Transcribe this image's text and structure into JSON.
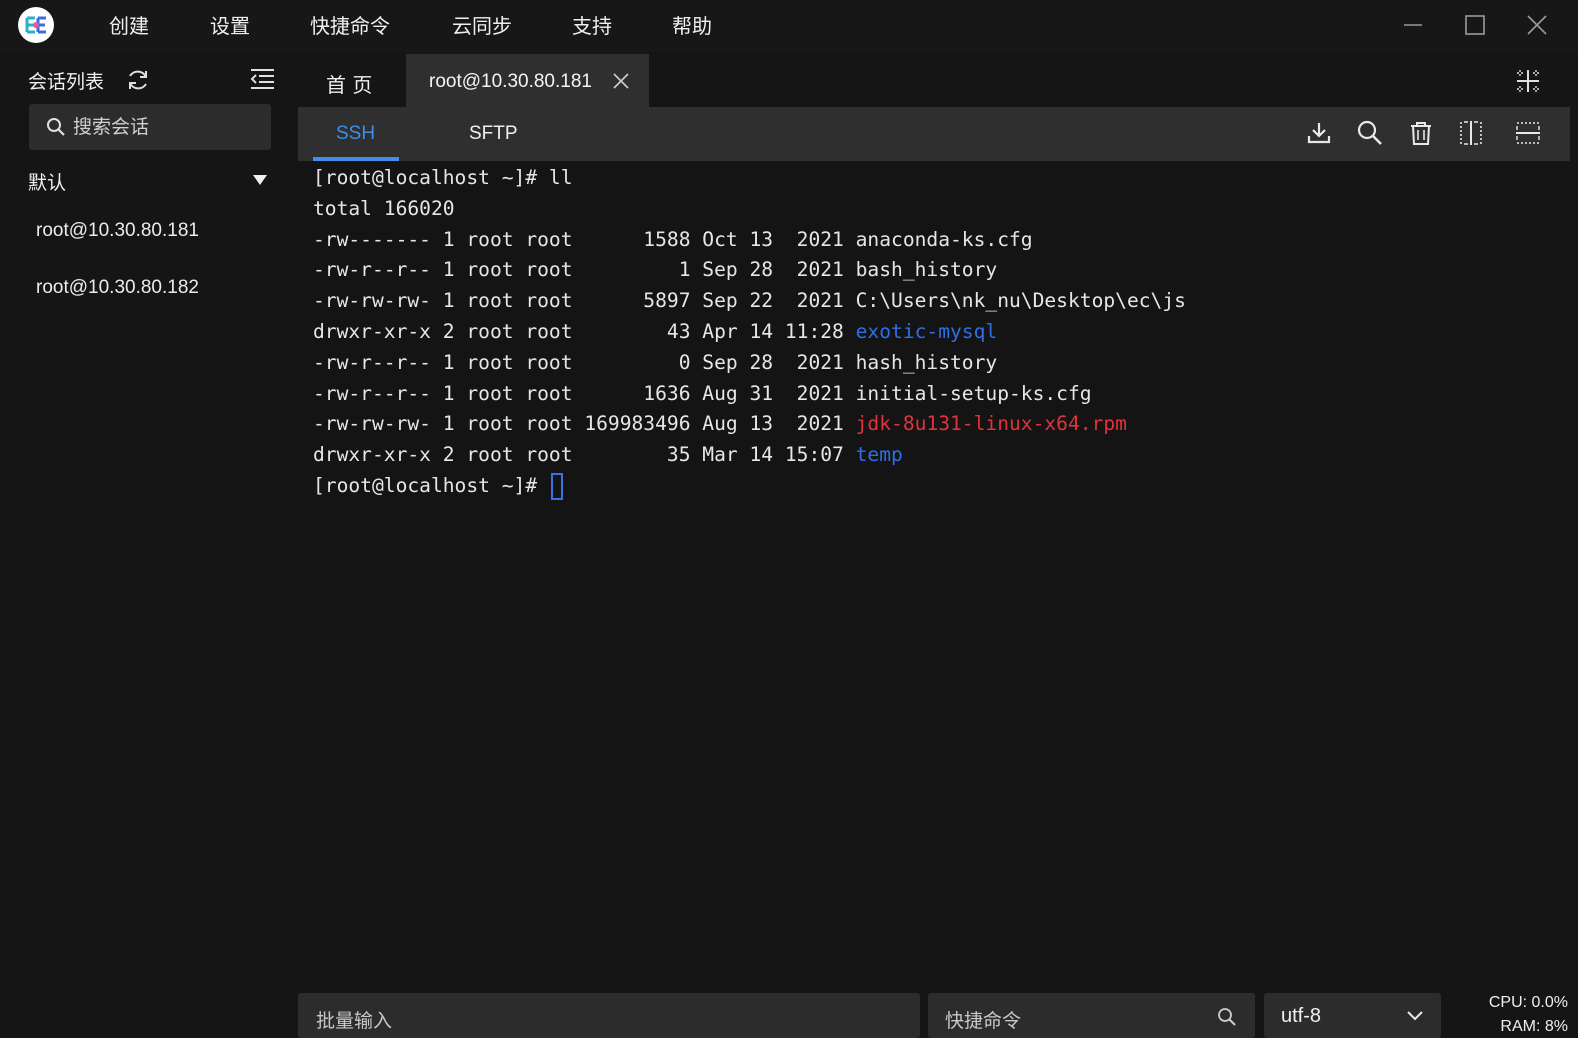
{
  "menu": {
    "items": [
      "创建",
      "设置",
      "快捷命令",
      "云同步",
      "支持",
      "帮助"
    ]
  },
  "sidebar": {
    "title": "会话列表",
    "search_placeholder": "搜索会话",
    "group_label": "默认",
    "sessions": [
      "root@10.30.80.181",
      "root@10.30.80.182"
    ]
  },
  "tabs": {
    "home": "首 页",
    "active": "root@10.30.80.181"
  },
  "subtabs": {
    "ssh": "SSH",
    "sftp": "SFTP"
  },
  "terminal": {
    "lines": [
      [
        {
          "t": "[root@localhost ~]# ll"
        }
      ],
      [
        {
          "t": "total 166020"
        }
      ],
      [
        {
          "t": "-rw------- 1 root root      1588 Oct 13  2021 anaconda-ks.cfg"
        }
      ],
      [
        {
          "t": "-rw-r--r-- 1 root root         1 Sep 28  2021 bash_history"
        }
      ],
      [
        {
          "t": "-rw-rw-rw- 1 root root      5897 Sep 22  2021 C:\\Users\\nk_nu\\Desktop\\ec\\js"
        }
      ],
      [
        {
          "t": "drwxr-xr-x 2 root root        43 Apr 14 11:28 "
        },
        {
          "t": "exotic-mysql",
          "c": "blue"
        }
      ],
      [
        {
          "t": "-rw-r--r-- 1 root root         0 Sep 28  2021 hash_history"
        }
      ],
      [
        {
          "t": "-rw-r--r-- 1 root root      1636 Aug 31  2021 initial-setup-ks.cfg"
        }
      ],
      [
        {
          "t": "-rw-rw-rw- 1 root root 169983496 Aug 13  2021 "
        },
        {
          "t": "jdk-8u131-linux-x64.rpm",
          "c": "red"
        }
      ],
      [
        {
          "t": "drwxr-xr-x 2 root root        35 Mar 14 15:07 "
        },
        {
          "t": "temp",
          "c": "blue"
        }
      ],
      [
        {
          "t": "[root@localhost ~]# "
        },
        {
          "cursor": true
        }
      ]
    ],
    "colors": {
      "directory": "#2e6fe6",
      "archive": "#e3323a",
      "accent": "#3d8fe8"
    }
  },
  "bottom": {
    "batch_placeholder": "批量输入",
    "quick_placeholder": "快捷命令",
    "encoding": "utf-8",
    "cpu": "CPU: 0.0%",
    "ram": "RAM: 8%"
  },
  "icons": {
    "logo": "app-logo-icon",
    "refresh": "refresh-icon",
    "collapse": "collapse-sidebar-icon",
    "search": "search-icon",
    "group_toggle": "caret-down-icon",
    "close": "close-icon",
    "layout": "split-layout-icon",
    "download": "download-icon",
    "find": "search-icon",
    "clear": "trash-icon",
    "split_v": "split-vertical-icon",
    "split_h": "split-horizontal-icon",
    "chevron": "chevron-down-icon",
    "minimize": "minimize-icon",
    "maximize": "maximize-icon",
    "window_close": "window-close-icon"
  }
}
